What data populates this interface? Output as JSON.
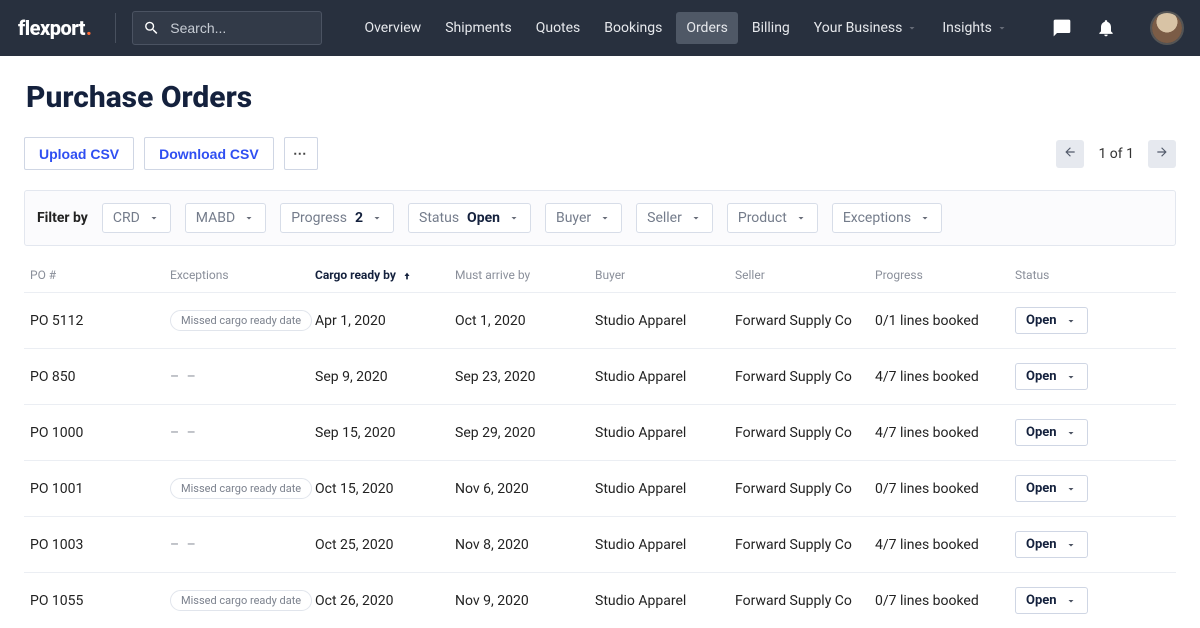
{
  "brand": {
    "name": "flexport",
    "dot": "."
  },
  "search": {
    "placeholder": "Search..."
  },
  "nav": {
    "items": [
      {
        "label": "Overview",
        "active": false,
        "caret": false
      },
      {
        "label": "Shipments",
        "active": false,
        "caret": false
      },
      {
        "label": "Quotes",
        "active": false,
        "caret": false
      },
      {
        "label": "Bookings",
        "active": false,
        "caret": false
      },
      {
        "label": "Orders",
        "active": true,
        "caret": false
      },
      {
        "label": "Billing",
        "active": false,
        "caret": false
      },
      {
        "label": "Your Business",
        "active": false,
        "caret": true
      },
      {
        "label": "Insights",
        "active": false,
        "caret": true
      }
    ]
  },
  "page": {
    "title": "Purchase Orders"
  },
  "toolbar": {
    "upload_label": "Upload CSV",
    "download_label": "Download CSV",
    "more_label": "⋯",
    "pagination_label": "1 of 1"
  },
  "filters": {
    "label": "Filter by",
    "chips": [
      {
        "segment": "CRD",
        "value": "",
        "name": "crd"
      },
      {
        "segment": "MABD",
        "value": "",
        "name": "mabd"
      },
      {
        "segment": "Progress",
        "value": "2",
        "name": "progress"
      },
      {
        "segment": "Status",
        "value": "Open",
        "name": "status"
      },
      {
        "segment": "Buyer",
        "value": "",
        "name": "buyer"
      },
      {
        "segment": "Seller",
        "value": "",
        "name": "seller"
      },
      {
        "segment": "Product",
        "value": "",
        "name": "product"
      },
      {
        "segment": "Exceptions",
        "value": "",
        "name": "exceptions"
      }
    ]
  },
  "table": {
    "headers": {
      "po": "PO #",
      "exceptions": "Exceptions",
      "cargo_ready": "Cargo ready by",
      "must_arrive": "Must arrive by",
      "buyer": "Buyer",
      "seller": "Seller",
      "progress": "Progress",
      "status": "Status"
    },
    "rows": [
      {
        "po": "PO 5112",
        "exception": "Missed cargo ready date",
        "cargo_ready": "Apr 1, 2020",
        "must_arrive": "Oct 1, 2020",
        "buyer": "Studio Apparel",
        "seller": "Forward Supply Co",
        "progress": "0/1 lines booked",
        "status": "Open"
      },
      {
        "po": "PO 850",
        "exception": "",
        "cargo_ready": "Sep 9, 2020",
        "must_arrive": "Sep 23, 2020",
        "buyer": "Studio Apparel",
        "seller": "Forward Supply Co",
        "progress": "4/7 lines booked",
        "status": "Open"
      },
      {
        "po": "PO 1000",
        "exception": "",
        "cargo_ready": "Sep 15, 2020",
        "must_arrive": "Sep 29, 2020",
        "buyer": "Studio Apparel",
        "seller": "Forward Supply Co",
        "progress": "4/7 lines booked",
        "status": "Open"
      },
      {
        "po": "PO 1001",
        "exception": "Missed cargo ready date",
        "cargo_ready": "Oct 15, 2020",
        "must_arrive": "Nov 6, 2020",
        "buyer": "Studio Apparel",
        "seller": "Forward Supply Co",
        "progress": "0/7 lines booked",
        "status": "Open"
      },
      {
        "po": "PO 1003",
        "exception": "",
        "cargo_ready": "Oct 25, 2020",
        "must_arrive": "Nov 8, 2020",
        "buyer": "Studio Apparel",
        "seller": "Forward Supply Co",
        "progress": "4/7 lines booked",
        "status": "Open"
      },
      {
        "po": "PO 1055",
        "exception": "Missed cargo ready date",
        "cargo_ready": "Oct 26, 2020",
        "must_arrive": "Nov 9, 2020",
        "buyer": "Studio Apparel",
        "seller": "Forward Supply Co",
        "progress": "0/7 lines booked",
        "status": "Open"
      }
    ],
    "dashes": "– –"
  }
}
